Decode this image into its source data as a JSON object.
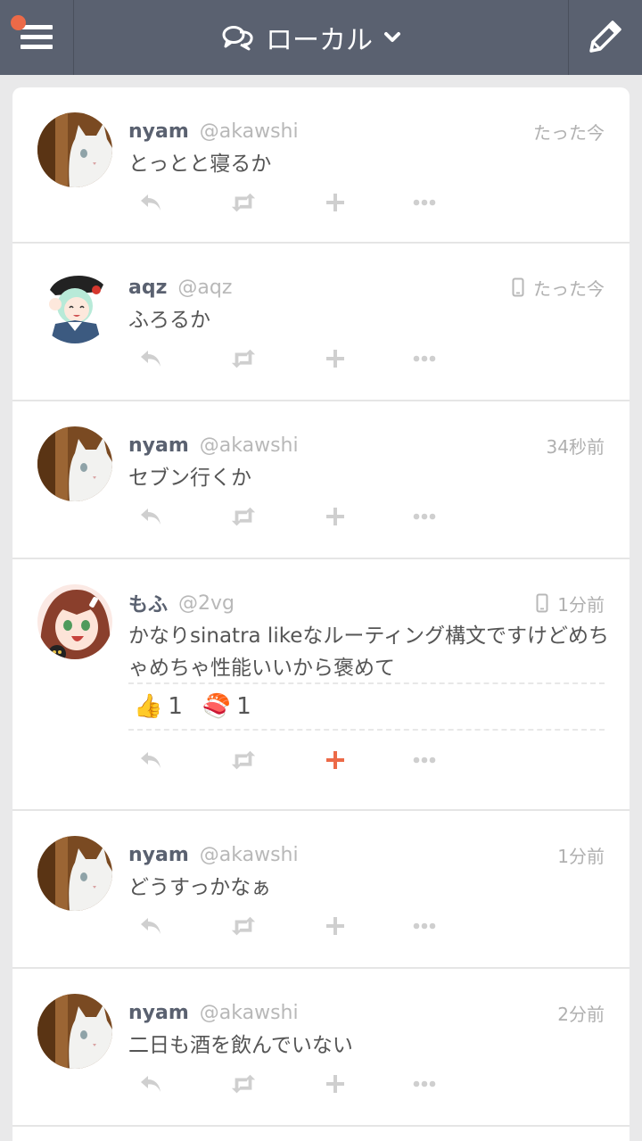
{
  "header": {
    "title": "ローカル",
    "icons": {
      "menu": "hamburger-icon",
      "notification": "notification-dot",
      "timeline": "chat-bubbles-icon",
      "dropdown": "chevron-down-icon",
      "compose": "pencil-icon"
    },
    "colors": {
      "bar": "#5a6170",
      "dot": "#ec6a48"
    }
  },
  "notes": [
    {
      "name": "nyam",
      "handle": "@akawshi",
      "time": "たった今",
      "text": "とっとと寝るか",
      "via_mobile": false
    },
    {
      "name": "aqz",
      "handle": "@aqz",
      "time": "たった今",
      "text": "ふろるか",
      "via_mobile": true
    },
    {
      "name": "nyam",
      "handle": "@akawshi",
      "time": "34秒前",
      "text": "セブン行くか",
      "via_mobile": false
    },
    {
      "name": "もふ",
      "handle": "@2vg",
      "time": "1分前",
      "text": "かなりsinatra likeなルーティング構文ですけどめちゃめちゃ性能いいから褒めて",
      "via_mobile": true,
      "reactions": [
        {
          "emoji": "👍",
          "count": "1"
        },
        {
          "emoji": "🍣",
          "count": "1"
        }
      ],
      "reacted": true
    },
    {
      "name": "nyam",
      "handle": "@akawshi",
      "time": "1分前",
      "text": "どうすっかなぁ",
      "via_mobile": false
    },
    {
      "name": "nyam",
      "handle": "@akawshi",
      "time": "2分前",
      "text": "二日も酒を飲んでいない",
      "via_mobile": false
    }
  ],
  "action_icons": [
    "reply-icon",
    "renote-icon",
    "reaction-plus-icon",
    "more-icon"
  ],
  "accent": "#ec6a48"
}
